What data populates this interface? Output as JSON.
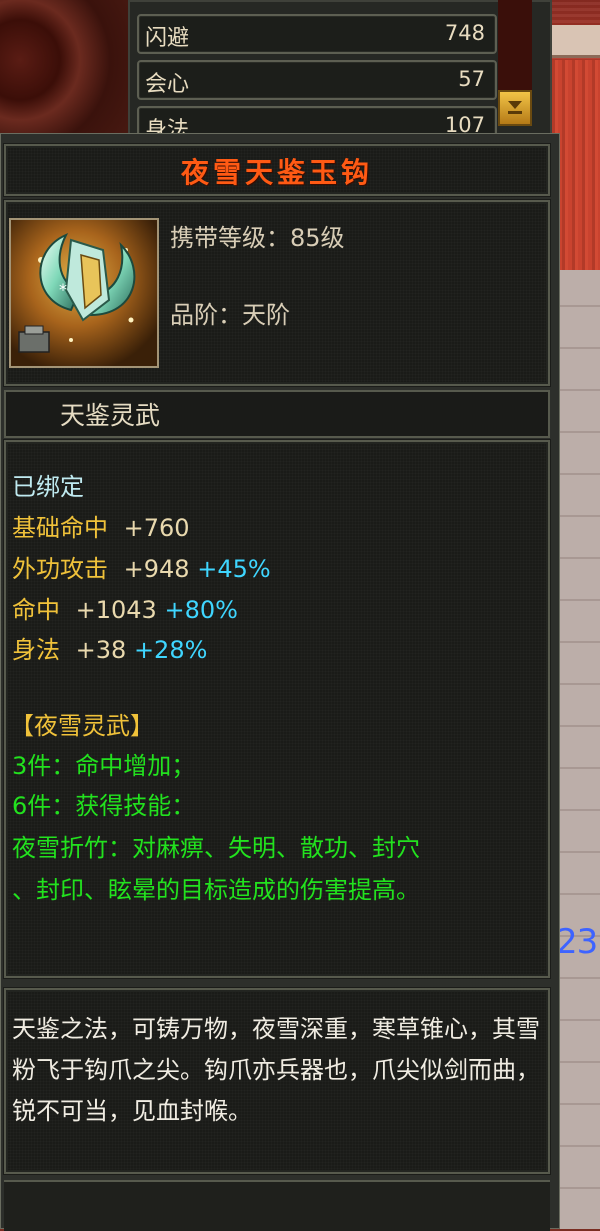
{
  "stats": [
    {
      "label": "闪避",
      "value": "748"
    },
    {
      "label": "会心",
      "value": "57"
    },
    {
      "label": "身法",
      "value": "107"
    }
  ],
  "item": {
    "name": "夜雪天鉴玉钩",
    "level_text": "携带等级：85级",
    "grade_text": "品阶：天阶",
    "category": "天鉴灵武",
    "bound": "已绑定",
    "attributes": [
      {
        "label": "基础命中",
        "base": "+760",
        "bonus": ""
      },
      {
        "label": "外功攻击",
        "base": "+948",
        "bonus": "+45%"
      },
      {
        "label": "命中",
        "base": "+1043",
        "bonus": "+80%"
      },
      {
        "label": "身法",
        "base": "+38",
        "bonus": "+28%"
      }
    ],
    "set_name": "【夜雪灵武】",
    "set_bonus_3": "3件：命中增加；",
    "set_bonus_6": "6件：获得技能：",
    "skill_line1": "夜雪折竹：对麻痹、失明、散功、封穴",
    "skill_line2": "、封印、眩晕的目标造成的伤害提高。",
    "description": "天鉴之法，可铸万物，夜雪深重，寒草锥心，其雪粉飞于钩爪之尖。钩爪亦兵器也，爪尖似剑而曲，锐不可当，见血封喉。"
  },
  "background": {
    "partial_number": "23"
  },
  "colors": {
    "title": "#ff5a14",
    "set_text": "#22e21e",
    "bonus_text": "#3fd6ff",
    "attribute_label": "#f0c23a"
  }
}
